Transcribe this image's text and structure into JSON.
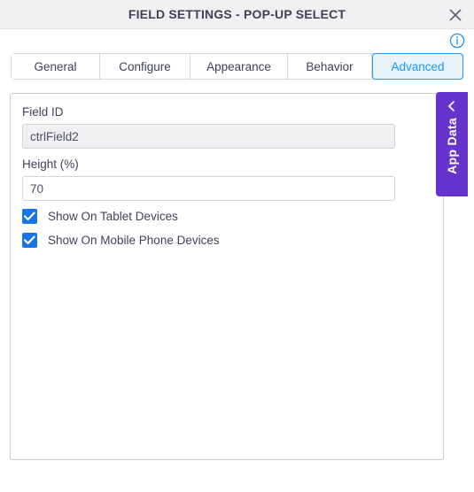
{
  "window": {
    "title": "FIELD SETTINGS - POP-UP SELECT",
    "close_icon": "close-icon",
    "info_icon": "info-icon"
  },
  "tabs": [
    {
      "label": "General",
      "active": false,
      "width": 100
    },
    {
      "label": "Configure",
      "active": false,
      "width": 102
    },
    {
      "label": "Appearance",
      "active": false,
      "width": 110
    },
    {
      "label": "Behavior",
      "active": false,
      "width": 95
    },
    {
      "label": "Advanced",
      "active": true,
      "width": 103
    }
  ],
  "form": {
    "field_id": {
      "label": "Field ID",
      "value": "ctrlField2",
      "readonly": true
    },
    "height": {
      "label": "Height (%)",
      "value": "70",
      "placeholder": "70",
      "readonly": false
    },
    "checkboxes": [
      {
        "label": "Show On Tablet Devices",
        "checked": true
      },
      {
        "label": "Show On Mobile Phone Devices",
        "checked": true
      }
    ]
  },
  "app_data_tab": {
    "label": "App Data",
    "chevron_icon": "chevron-left-icon"
  },
  "colors": {
    "accent_blue": "#2196f3",
    "active_tab_bg": "#e8f3fc",
    "checkbox_blue": "#1a73e8",
    "app_data_purple": "#6633cc",
    "titlebar_bg": "#f0f0f2",
    "text": "#3f4257"
  }
}
